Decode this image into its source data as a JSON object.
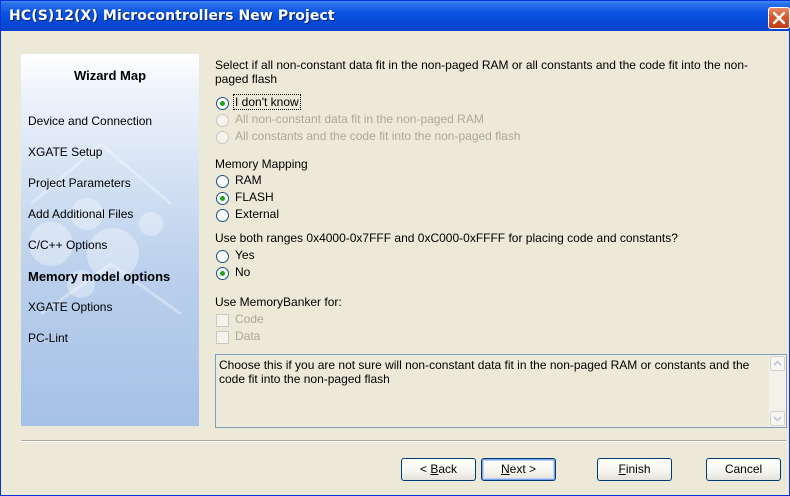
{
  "window": {
    "title": "HC(S)12(X) Microcontrollers New Project"
  },
  "sidebar": {
    "title": "Wizard Map",
    "items": [
      {
        "label": "Device and Connection",
        "active": false
      },
      {
        "label": "XGATE Setup",
        "active": false
      },
      {
        "label": "Project Parameters",
        "active": false
      },
      {
        "label": "Add Additional Files",
        "active": false
      },
      {
        "label": "C/C++ Options",
        "active": false
      },
      {
        "label": "Memory model options",
        "active": true
      },
      {
        "label": "XGATE Options",
        "active": false
      },
      {
        "label": "PC-Lint",
        "active": false
      }
    ]
  },
  "main": {
    "question1": "Select if all non-constant data fit in the non-paged RAM or all constants and the code fit into the non-paged flash",
    "fit_options": [
      {
        "label": "I don't know",
        "checked": true,
        "enabled": true
      },
      {
        "label": "All non-constant data fit in the non-paged RAM",
        "checked": false,
        "enabled": false
      },
      {
        "label": "All constants and the code fit into the non-paged flash",
        "checked": false,
        "enabled": false
      }
    ],
    "mapping_label": "Memory Mapping",
    "mapping_options": [
      {
        "label": "RAM",
        "checked": false
      },
      {
        "label": "FLASH",
        "checked": true
      },
      {
        "label": "External",
        "checked": false
      }
    ],
    "question2": "Use both ranges 0x4000-0x7FFF and 0xC000-0xFFFF for placing code and constants?",
    "range_options": [
      {
        "label": "Yes",
        "checked": false
      },
      {
        "label": "No",
        "checked": true
      }
    ],
    "banker_label": "Use MemoryBanker for:",
    "banker_options": [
      {
        "label": "Code",
        "checked": false,
        "enabled": false
      },
      {
        "label": "Data",
        "checked": false,
        "enabled": false
      }
    ],
    "help_text": "Choose this if you are not sure will non-constant data fit in the non-paged RAM or constants and the code fit into the non-paged flash"
  },
  "buttons": {
    "back": {
      "pre": "< ",
      "accel": "B",
      "post": "ack"
    },
    "next": {
      "accel": "N",
      "post": "ext >"
    },
    "finish": {
      "accel": "F",
      "post": "inish"
    },
    "cancel": "Cancel"
  },
  "colors": {
    "titlebar": "#0a54e2",
    "radio_dot": "#21a121",
    "face": "#ece9d8"
  }
}
